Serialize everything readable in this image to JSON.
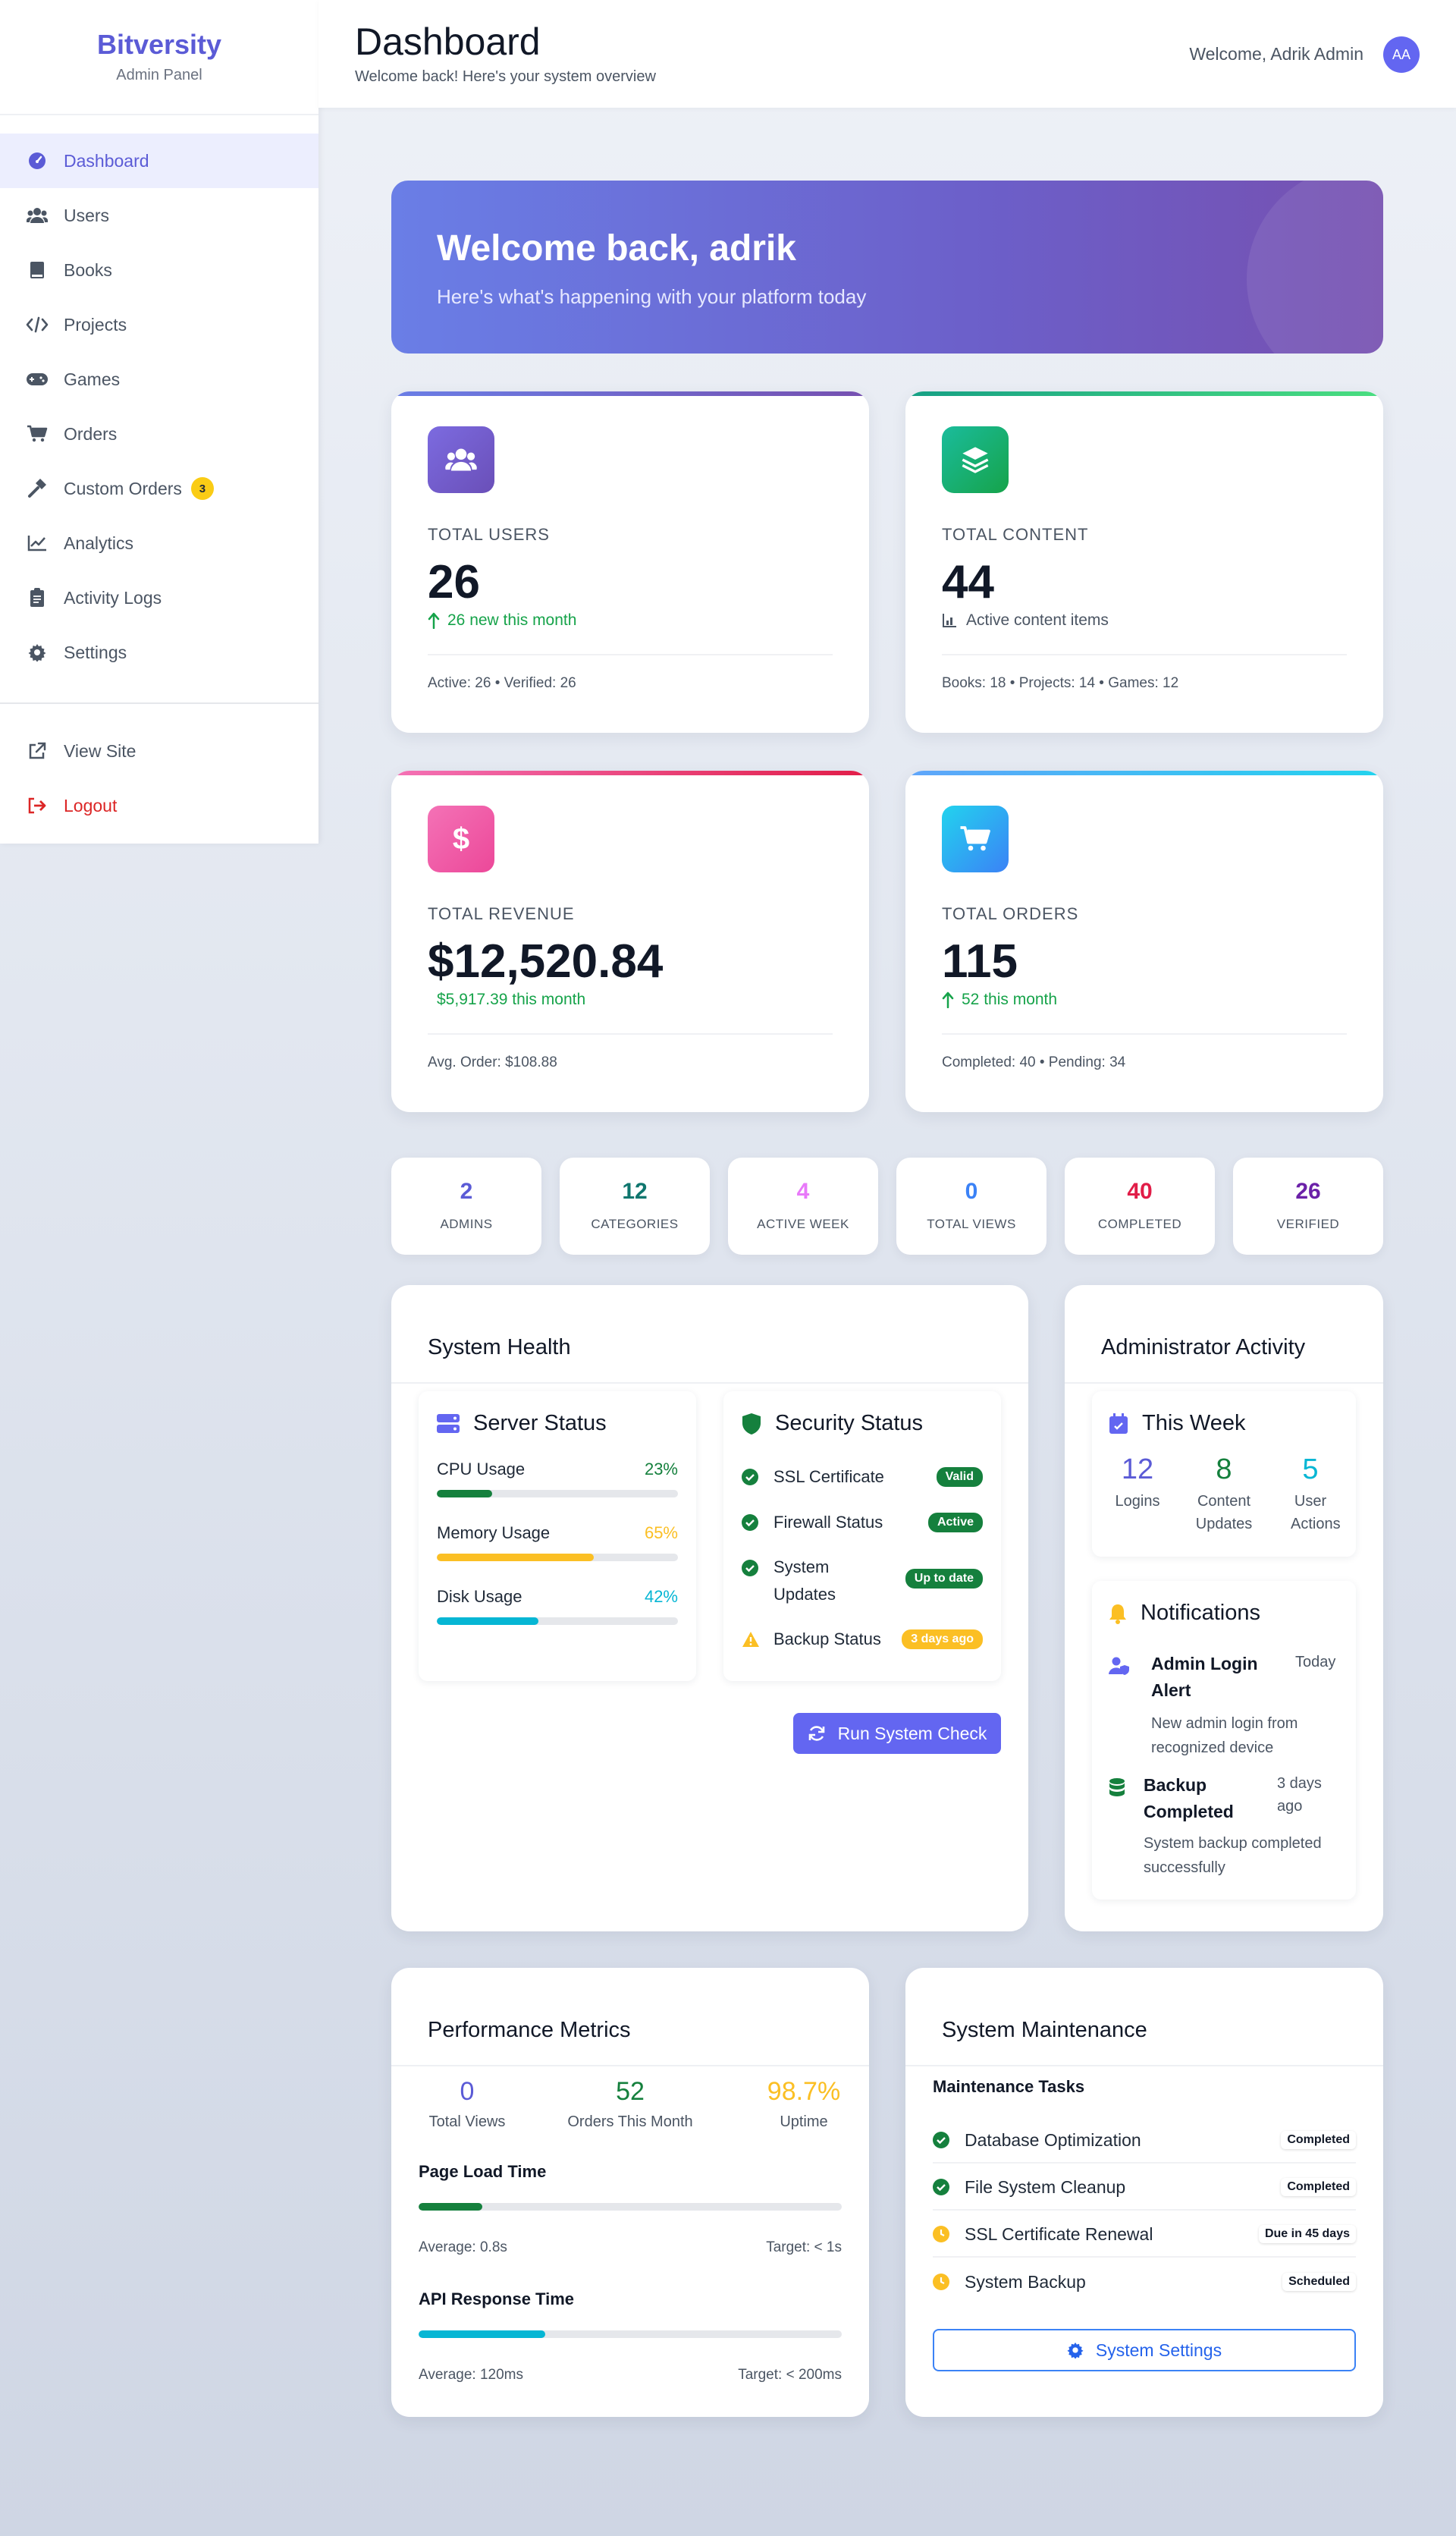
{
  "brand": {
    "name": "Bitversity",
    "subtitle": "Admin Panel"
  },
  "sidebar": {
    "items": [
      {
        "label": "Dashboard",
        "icon": "dashboard-icon",
        "active": true
      },
      {
        "label": "Users",
        "icon": "users-icon"
      },
      {
        "label": "Books",
        "icon": "book-icon"
      },
      {
        "label": "Projects",
        "icon": "code-icon"
      },
      {
        "label": "Games",
        "icon": "gamepad-icon"
      },
      {
        "label": "Orders",
        "icon": "cart-icon"
      },
      {
        "label": "Custom Orders",
        "icon": "hammer-icon",
        "badge": "3"
      },
      {
        "label": "Analytics",
        "icon": "chart-line-icon"
      },
      {
        "label": "Activity Logs",
        "icon": "clipboard-icon"
      },
      {
        "label": "Settings",
        "icon": "gear-icon"
      }
    ],
    "footer": [
      {
        "label": "View Site",
        "icon": "external-link-icon"
      },
      {
        "label": "Logout",
        "icon": "logout-icon"
      }
    ]
  },
  "header": {
    "title": "Dashboard",
    "subtitle": "Welcome back! Here's your system overview",
    "welcome": "Welcome, Adrik Admin",
    "avatar": "AA"
  },
  "hero": {
    "title": "Welcome back, adrik",
    "subtitle": "Here's what's happening with your platform today"
  },
  "stats": [
    {
      "label": "TOTAL USERS",
      "value": "26",
      "trend": "26 new this month",
      "footer": "Active: 26 • Verified: 26",
      "color": "#7b5fd6"
    },
    {
      "label": "TOTAL CONTENT",
      "value": "44",
      "trend": "Active content items",
      "footer": "Books: 18 • Projects: 14 • Games: 12",
      "color": "#16a085"
    },
    {
      "label": "TOTAL REVENUE",
      "value": "$12,520.84",
      "trend": "$5,917.39 this month",
      "footer": "Avg. Order: $108.88",
      "color": "#ec4899"
    },
    {
      "label": "TOTAL ORDERS",
      "value": "115",
      "trend": "52 this month",
      "footer": "Completed: 40 • Pending: 34",
      "color": "#22d3ee"
    }
  ],
  "mini_stats": [
    {
      "value": "2",
      "label": "ADMINS",
      "color": "#5b5bd6"
    },
    {
      "value": "12",
      "label": "CATEGORIES",
      "color": "#0f766e"
    },
    {
      "value": "4",
      "label": "ACTIVE WEEK",
      "color": "#e879f9"
    },
    {
      "value": "0",
      "label": "TOTAL VIEWS",
      "color": "#3b82f6"
    },
    {
      "value": "40",
      "label": "COMPLETED",
      "color": "#e11d48"
    },
    {
      "value": "26",
      "label": "VERIFIED",
      "color": "#6b21a8"
    }
  ],
  "system_health": {
    "title": "System Health",
    "server": {
      "title": "Server Status",
      "metrics": [
        {
          "label": "CPU Usage",
          "pct": "23%",
          "value": 0.23,
          "color": "#15803d"
        },
        {
          "label": "Memory Usage",
          "pct": "65%",
          "value": 0.65,
          "color": "#fbbf24"
        },
        {
          "label": "Disk Usage",
          "pct": "42%",
          "value": 0.42,
          "color": "#06b6d4"
        }
      ]
    },
    "security": {
      "title": "Security Status",
      "items": [
        {
          "label": "SSL Certificate",
          "status": "Valid",
          "color": "#15803d"
        },
        {
          "label": "Firewall Status",
          "status": "Active",
          "color": "#15803d"
        },
        {
          "label": "System Updates",
          "status": "Up to date",
          "color": "#15803d"
        },
        {
          "label": "Backup Status",
          "status": "3 days ago",
          "color": "#fbbf24"
        }
      ]
    },
    "button": "Run System Check"
  },
  "admin_activity": {
    "title": "Administrator Activity",
    "week": {
      "title": "This Week",
      "items": [
        {
          "value": "12",
          "label": "Logins",
          "color": "#5b5bd6"
        },
        {
          "value": "8",
          "label": "Content Updates",
          "color": "#15803d"
        },
        {
          "value": "5",
          "label": "User Actions",
          "color": "#06b6d4"
        }
      ]
    },
    "notifications": {
      "title": "Notifications",
      "items": [
        {
          "title": "Admin Login Alert",
          "time": "Today",
          "body": "New admin login from recognized device"
        },
        {
          "title": "Backup Completed",
          "time": "3 days ago",
          "body": "System backup completed successfully"
        }
      ]
    }
  },
  "performance": {
    "title": "Performance Metrics",
    "stats": [
      {
        "value": "0",
        "label": "Total Views",
        "color": "#5b5bd6"
      },
      {
        "value": "52",
        "label": "Orders This Month",
        "color": "#15803d"
      },
      {
        "value": "98.7%",
        "label": "Uptime",
        "color": "#fbbf24"
      }
    ],
    "bars": [
      {
        "title": "Page Load Time",
        "left": "Average: 0.8s",
        "right": "Target: < 1s",
        "value": 0.15,
        "color": "#15803d"
      },
      {
        "title": "API Response Time",
        "left": "Average: 120ms",
        "right": "Target: < 200ms",
        "value": 0.3,
        "color": "#06b6d4"
      }
    ]
  },
  "maintenance": {
    "title": "System Maintenance",
    "subtitle": "Maintenance Tasks",
    "tasks": [
      {
        "label": "Database Optimization",
        "status": "Completed",
        "icon": "check-circle-icon"
      },
      {
        "label": "File System Cleanup",
        "status": "Completed",
        "icon": "check-circle-icon"
      },
      {
        "label": "SSL Certificate Renewal",
        "status": "Due in 45 days",
        "icon": "clock-icon"
      },
      {
        "label": "System Backup",
        "status": "Scheduled",
        "icon": "clock-icon"
      }
    ],
    "button": "System Settings"
  }
}
